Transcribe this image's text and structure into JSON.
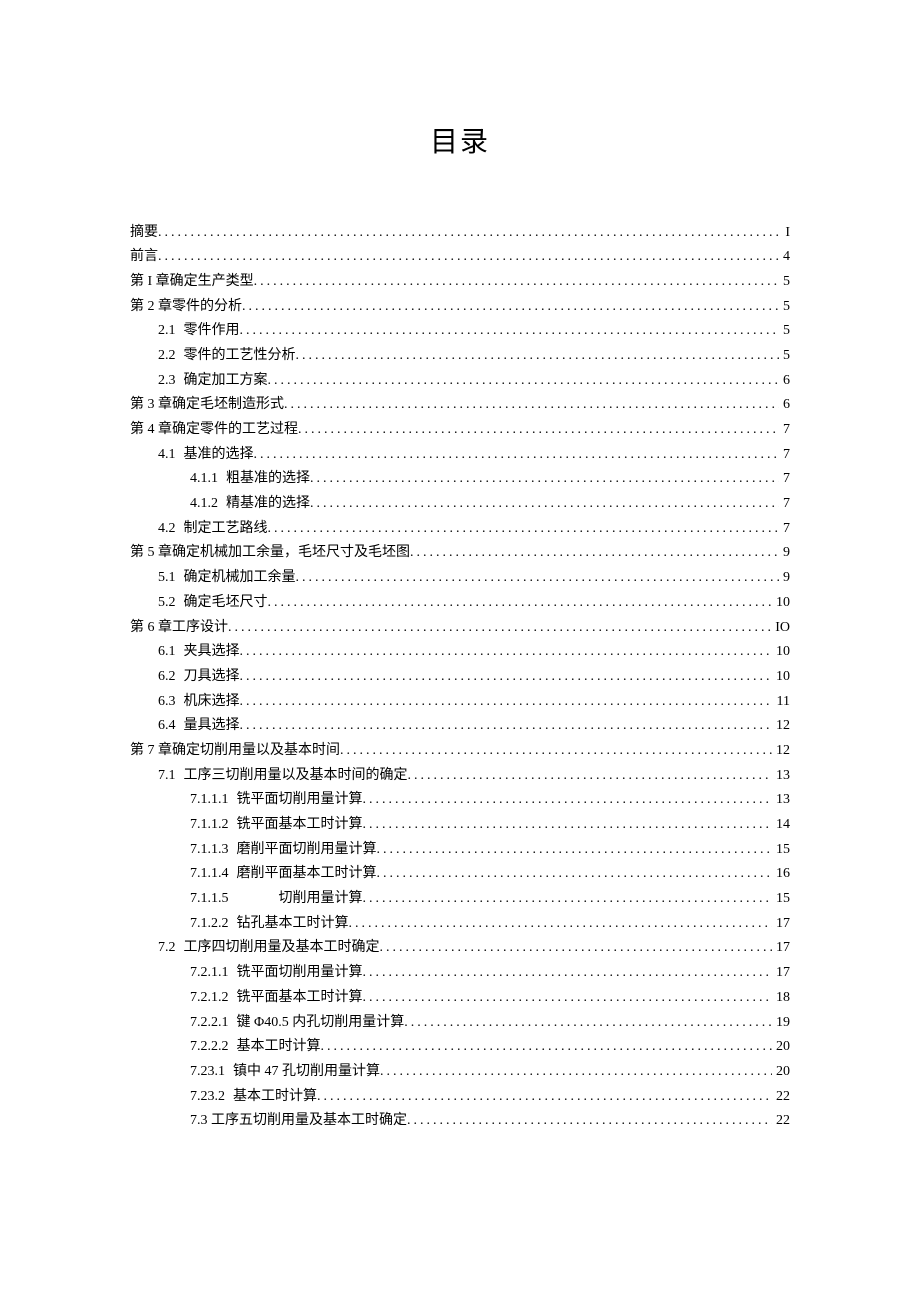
{
  "title": "目录",
  "toc": [
    {
      "indent": 0,
      "num": "",
      "label": "摘要",
      "page": "I"
    },
    {
      "indent": 0,
      "num": "",
      "label": "前言",
      "page": "4"
    },
    {
      "indent": 0,
      "num": "",
      "label": "第 I 章确定生产类型",
      "page": "5"
    },
    {
      "indent": 0,
      "num": "",
      "label": "第 2 章零件的分析",
      "page": "5"
    },
    {
      "indent": 1,
      "num": "2.1",
      "label": "零件作用",
      "page": "5"
    },
    {
      "indent": 1,
      "num": "2.2",
      "label": "零件的工艺性分析",
      "page": "5"
    },
    {
      "indent": 1,
      "num": "2.3",
      "label": "确定加工方案",
      "page": "6"
    },
    {
      "indent": 0,
      "num": "",
      "label": "第 3 章确定毛坯制造形式",
      "page": "6"
    },
    {
      "indent": 0,
      "num": "",
      "label": "第 4 章确定零件的工艺过程",
      "page": "7"
    },
    {
      "indent": 1,
      "num": "4.1",
      "label": "基准的选择",
      "page": "7"
    },
    {
      "indent": 2,
      "num": "4.1.1",
      "label": "粗基准的选择",
      "page": "7"
    },
    {
      "indent": 2,
      "num": "4.1.2",
      "label": "精基准的选择",
      "page": "7"
    },
    {
      "indent": 1,
      "num": "4.2",
      "label": "制定工艺路线",
      "page": "7"
    },
    {
      "indent": 0,
      "num": "",
      "label": "第 5 章确定机械加工余量，毛坯尺寸及毛坯图",
      "page": "9"
    },
    {
      "indent": 1,
      "num": "5.1",
      "label": "确定机械加工余量",
      "page": "9"
    },
    {
      "indent": 1,
      "num": "5.2",
      "label": "确定毛坯尺寸",
      "page": "10"
    },
    {
      "indent": 0,
      "num": "",
      "label": "第 6 章工序设计",
      "page": "IO"
    },
    {
      "indent": 1,
      "num": "6.1",
      "label": "夹具选择",
      "page": "10"
    },
    {
      "indent": 1,
      "num": "6.2",
      "label": "刀具选择",
      "page": "10"
    },
    {
      "indent": 1,
      "num": "6.3",
      "label": "机床选择",
      "page": "11"
    },
    {
      "indent": 1,
      "num": "6.4",
      "label": "量具选择",
      "page": "12"
    },
    {
      "indent": 0,
      "num": "",
      "label": "第 7 章确定切削用量以及基本时间",
      "page": "12"
    },
    {
      "indent": 1,
      "num": "7.1",
      "label": "工序三切削用量以及基本时间的确定",
      "page": "13"
    },
    {
      "indent": 2,
      "num": "7.1.1.1",
      "label": "铣平面切削用量计算",
      "page": "13"
    },
    {
      "indent": 2,
      "num": "7.1.1.2",
      "label": "铣平面基本工时计算",
      "page": "14"
    },
    {
      "indent": 2,
      "num": "7.1.1.3",
      "label": "磨削平面切削用量计算",
      "page": "15"
    },
    {
      "indent": 2,
      "num": "7.1.1.4",
      "label": "磨削平面基本工时计算",
      "page": "16"
    },
    {
      "indent": 2,
      "num": "7.1.1.5",
      "label": "　　　切削用量计算",
      "page": "15"
    },
    {
      "indent": 2,
      "num": "7.1.2.2",
      "label": "钻孔基本工时计算",
      "page": "17"
    },
    {
      "indent": 1,
      "num": "7.2",
      "label": "工序四切削用量及基本工时确定",
      "page": "17"
    },
    {
      "indent": 2,
      "num": "7.2.1.1",
      "label": "铣平面切削用量计算",
      "page": "17"
    },
    {
      "indent": 2,
      "num": "7.2.1.2",
      "label": "铣平面基本工时计算",
      "page": "18"
    },
    {
      "indent": 2,
      "num": "7.2.2.1",
      "label": "键 Φ40.5 内孔切削用量计算",
      "page": "19"
    },
    {
      "indent": 2,
      "num": "7.2.2.2",
      "label": "基本工时计算",
      "page": "20"
    },
    {
      "indent": 2,
      "num": "7.23.1",
      "label": "镇中 47 孔切削用量计算",
      "page": "20"
    },
    {
      "indent": 2,
      "num": "7.23.2",
      "label": "基本工时计算",
      "page": "22"
    },
    {
      "indent": 2,
      "num": "",
      "label": "7.3 工序五切削用量及基本工时确定",
      "page": "22"
    }
  ]
}
